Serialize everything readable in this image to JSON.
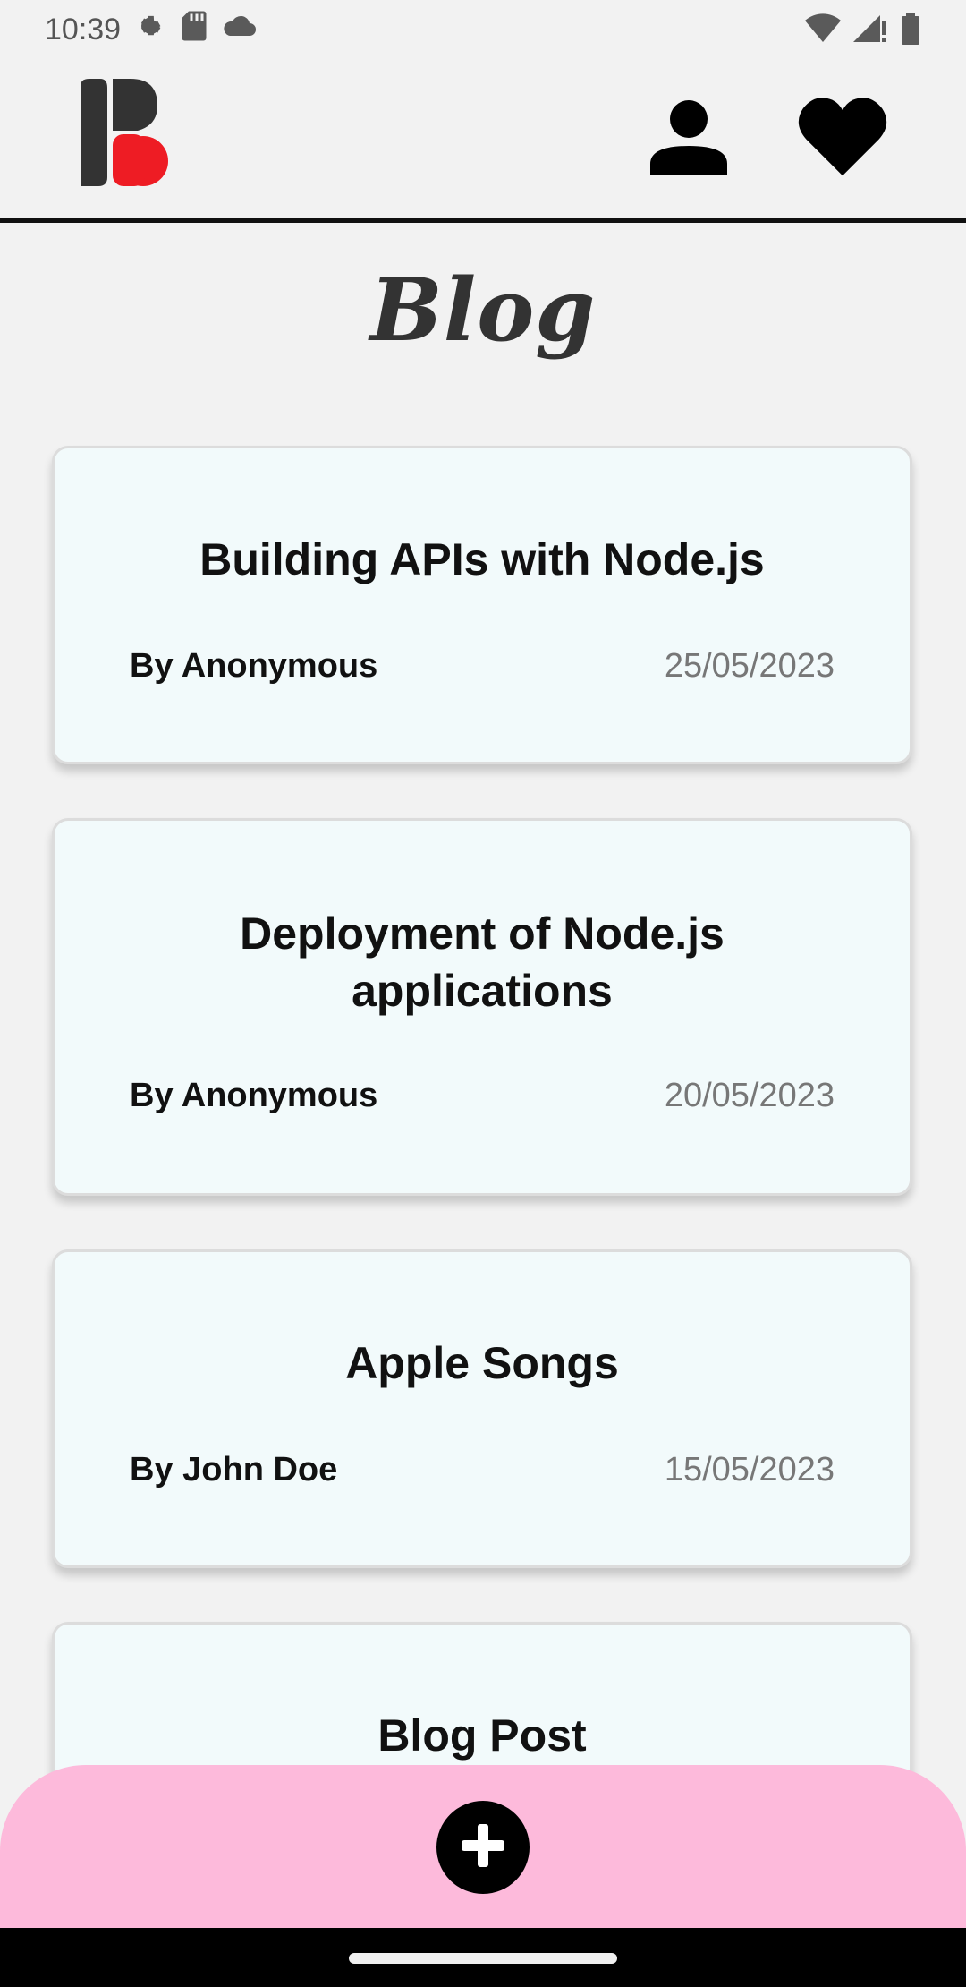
{
  "status_bar": {
    "time": "10:39",
    "icons": [
      "settings-gear-icon",
      "sd-card-icon",
      "cloud-icon",
      "wifi-icon",
      "signal-icon",
      "battery-icon"
    ]
  },
  "header": {
    "logo_icon": "brand-logo",
    "profile_icon": "person-icon",
    "favorites_icon": "heart-icon"
  },
  "page": {
    "title": "Blog"
  },
  "posts": [
    {
      "title": "Building APIs with Node.js",
      "author": "By Anonymous",
      "date": "25/05/2023"
    },
    {
      "title_line1": "Deployment of Node.js",
      "title_line2": "applications",
      "author": "By Anonymous",
      "date": "20/05/2023"
    },
    {
      "title": "Apple Songs",
      "author": "By John Doe",
      "date": "15/05/2023"
    },
    {
      "title": "Blog Post"
    }
  ],
  "bottom_bar": {
    "add_icon": "plus-circle-icon"
  },
  "colors": {
    "background": "#f2f2f2",
    "card_background": "#f2fafb",
    "bottom_bar": "#fdbadb",
    "logo_accent": "#ee1c24",
    "logo_dark": "#333333"
  }
}
